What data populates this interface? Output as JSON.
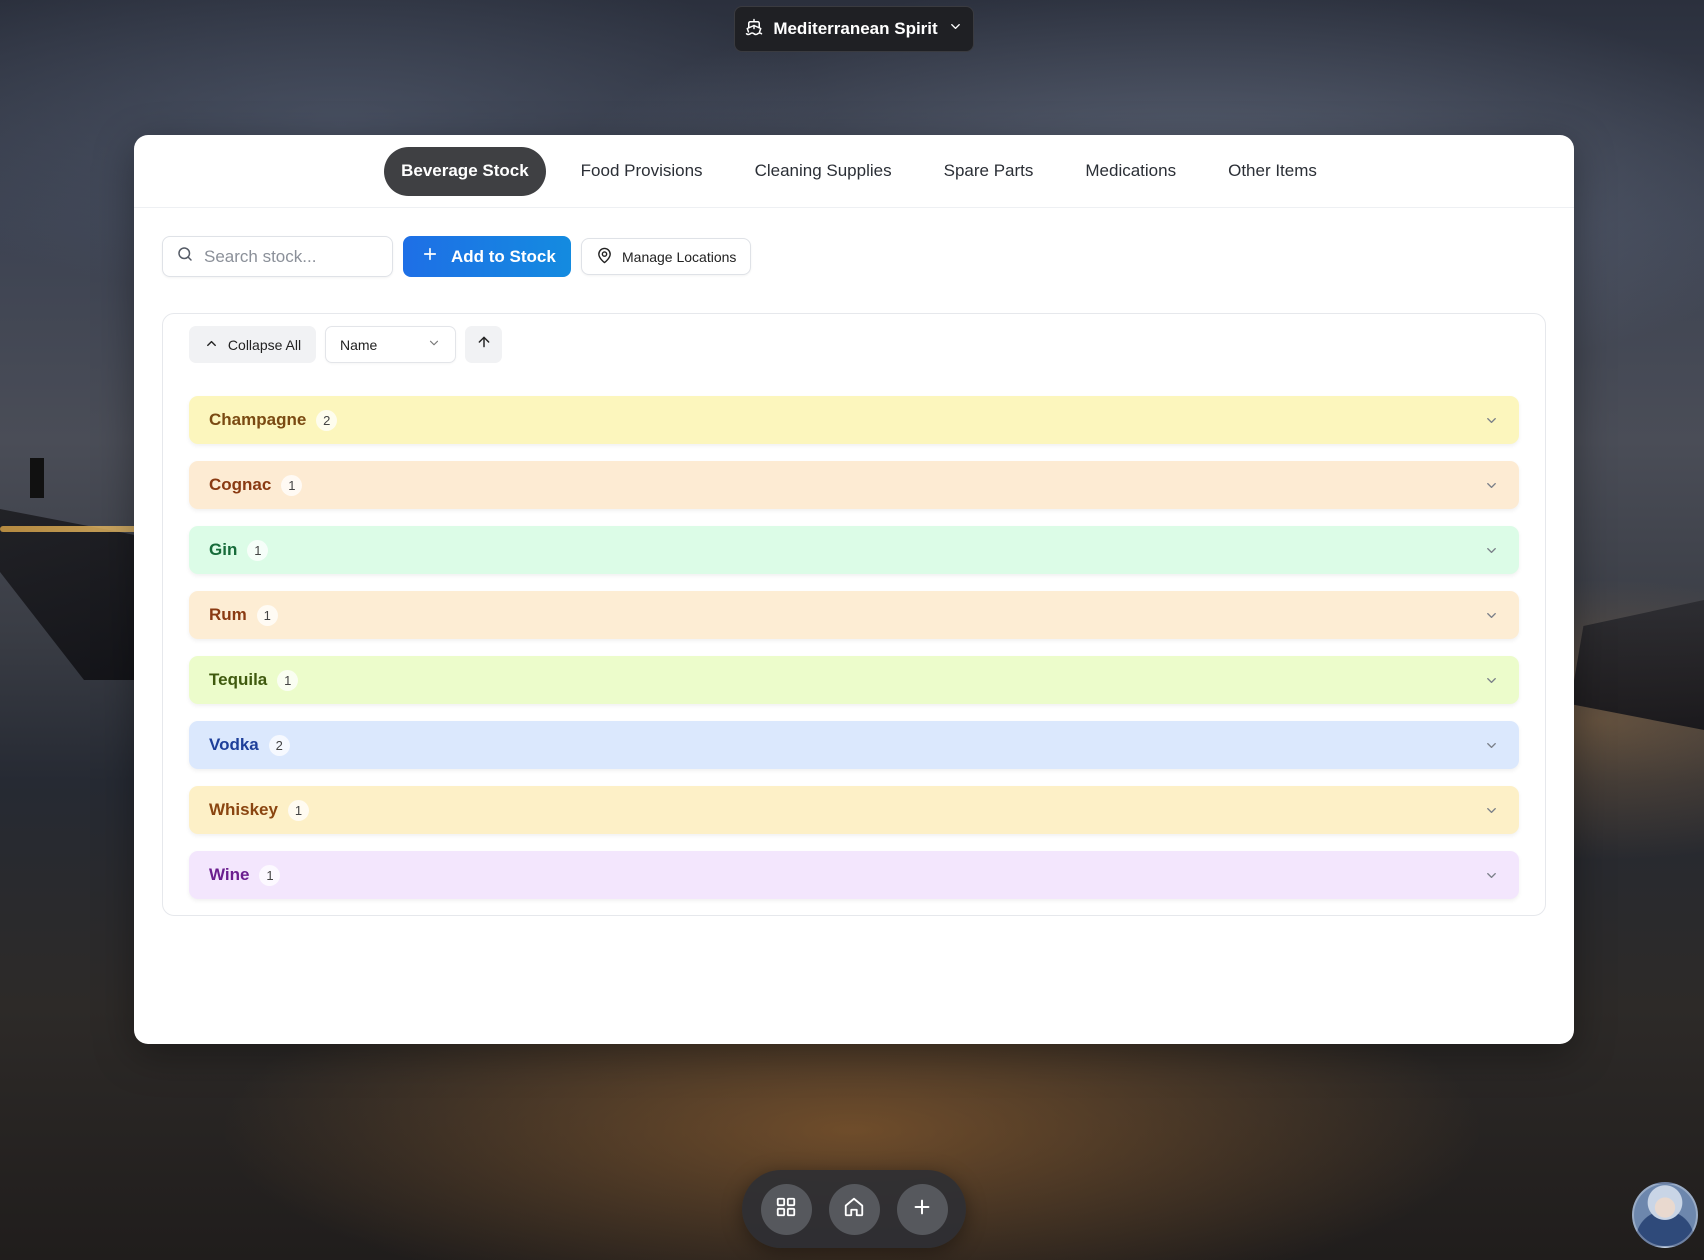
{
  "ship_selector": {
    "label": "Mediterranean Spirit"
  },
  "tabs": [
    {
      "label": "Beverage Stock",
      "active": true
    },
    {
      "label": "Food Provisions",
      "active": false
    },
    {
      "label": "Cleaning Supplies",
      "active": false
    },
    {
      "label": "Spare Parts",
      "active": false
    },
    {
      "label": "Medications",
      "active": false
    },
    {
      "label": "Other Items",
      "active": false
    }
  ],
  "toolbar": {
    "search_placeholder": "Search stock...",
    "add_label": "Add to Stock",
    "locations_label": "Manage Locations"
  },
  "controls": {
    "collapse_label": "Collapse All",
    "sort_value": "Name",
    "sort_direction": "ascending"
  },
  "categories": [
    {
      "name": "Champagne",
      "count": "2",
      "bg": "#fcf6bd",
      "color": "#7a4a12"
    },
    {
      "name": "Cognac",
      "count": "1",
      "bg": "#fdebd3",
      "color": "#8a3a12"
    },
    {
      "name": "Gin",
      "count": "1",
      "bg": "#dcfce7",
      "color": "#176b3a"
    },
    {
      "name": "Rum",
      "count": "1",
      "bg": "#fdedd4",
      "color": "#8a3a12"
    },
    {
      "name": "Tequila",
      "count": "1",
      "bg": "#ecfccb",
      "color": "#3f5a0e"
    },
    {
      "name": "Vodka",
      "count": "2",
      "bg": "#dbe8fd",
      "color": "#1e3f9a"
    },
    {
      "name": "Whiskey",
      "count": "1",
      "bg": "#fdf0c7",
      "color": "#8a4510"
    },
    {
      "name": "Wine",
      "count": "1",
      "bg": "#f3e6fd",
      "color": "#6b1e8f"
    }
  ],
  "dock": [
    "grid-icon",
    "home-icon",
    "plus-icon"
  ],
  "colors": {
    "accent": "#1e6fe6",
    "active_tab": "#3f4043"
  }
}
